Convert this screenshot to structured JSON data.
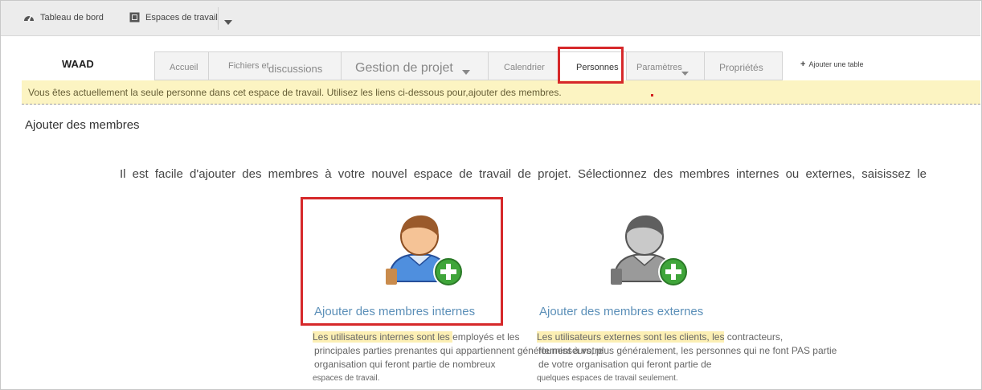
{
  "topbar": {
    "dashboard_label": "Tableau de bord",
    "workspaces_label": "Espaces de travail",
    "dashboard_icon": "gauge-icon",
    "workspaces_icon": "workspace-icon",
    "menu_icon": "caret-down-icon"
  },
  "workspace": {
    "title": "WAAD"
  },
  "tabs": [
    {
      "label": "Accueil"
    },
    {
      "label_line1": "Fichiers et",
      "label_line2": "discussions"
    },
    {
      "label": "Gestion de projet"
    },
    {
      "label": "Calendrier"
    },
    {
      "label": "Personnes"
    },
    {
      "label": "Paramètres"
    },
    {
      "label": "Propriétés"
    }
  ],
  "add_table": {
    "label": "Ajouter une table"
  },
  "notice": {
    "text": "Vous êtes actuellement la seule personne dans cet espace de travail. Utilisez les liens ci-dessous pour,ajouter des membres."
  },
  "section": {
    "title": "Ajouter des membres",
    "intro": "Il est facile d'ajouter des membres à votre nouvel espace de travail de projet. Sélectionnez des membres internes ou externes, saisissez le"
  },
  "internal": {
    "link": "Ajouter des membres internes",
    "desc_line1_hl": "Les utilisateurs internes sont les ",
    "desc_line1_rest": "employés et les",
    "desc_line2": "principales parties prenantes qui appartiennent générlement à votre",
    "desc_line3": "organisation qui feront partie de nombreux",
    "desc_line4": "espaces de travail.",
    "icon": "internal-member-add-icon"
  },
  "external": {
    "link": "Ajouter des membres externes",
    "desc_line1_hl": "Les utilisateurs externes sont les clients, les",
    "desc_line1_rest": " contracteurs,",
    "desc_line2": "fournisseurs, plus généralement, les personnes qui ne font PAS partie",
    "desc_line3": "de votre organisation qui feront partie de",
    "desc_line4": "quelques espaces de travail seulement.",
    "icon": "external-member-add-icon"
  },
  "colors": {
    "highlight_box": "#d6282a",
    "link": "#5b8fb8",
    "notice_bg": "#fcf4c2"
  }
}
